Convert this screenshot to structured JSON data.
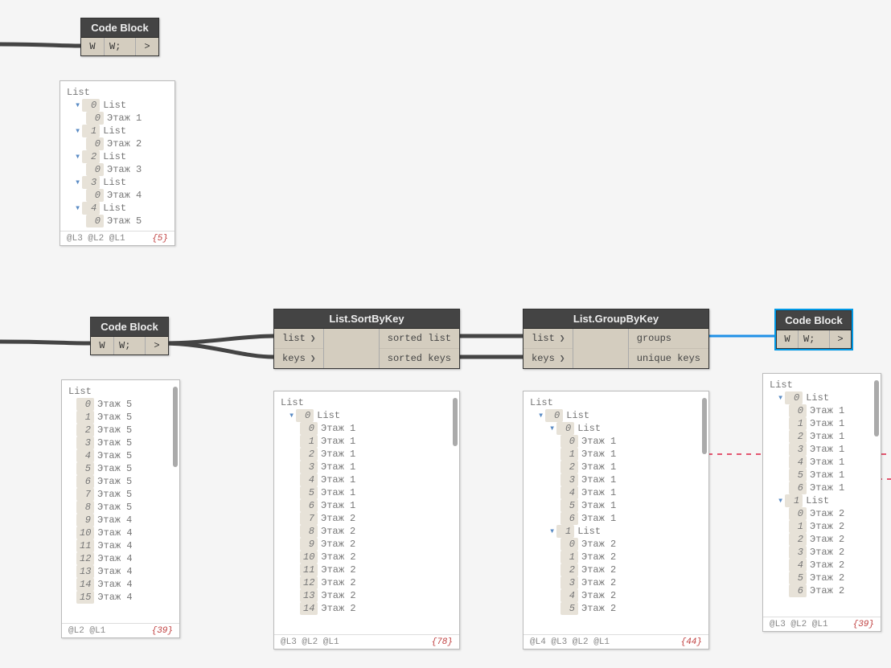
{
  "nodes": {
    "cb1": {
      "title": "Code Block",
      "in": "W",
      "code": "W;",
      "out": ">"
    },
    "cb2": {
      "title": "Code Block",
      "in": "W",
      "code": "W;",
      "out": ">"
    },
    "cb3": {
      "title": "Code Block",
      "in": "W",
      "code": "W;",
      "out": ">"
    },
    "sort": {
      "title": "List.SortByKey",
      "in": [
        {
          "label": "list"
        },
        {
          "label": "keys"
        }
      ],
      "out": [
        {
          "label": "sorted list"
        },
        {
          "label": "sorted keys"
        }
      ]
    },
    "group": {
      "title": "List.GroupByKey",
      "in": [
        {
          "label": "list"
        },
        {
          "label": "keys"
        }
      ],
      "out": [
        {
          "label": "groups"
        },
        {
          "label": "unique keys"
        }
      ]
    }
  },
  "previews": {
    "p1": {
      "levels": "@L3 @L2 @L1",
      "count": "{5}",
      "root": "List",
      "items": [
        {
          "idx": "0",
          "sub": "List",
          "child": {
            "idx": "0",
            "val": "Этаж 1"
          }
        },
        {
          "idx": "1",
          "sub": "List",
          "child": {
            "idx": "0",
            "val": "Этаж 2"
          }
        },
        {
          "idx": "2",
          "sub": "List",
          "child": {
            "idx": "0",
            "val": "Этаж 3"
          }
        },
        {
          "idx": "3",
          "sub": "List",
          "child": {
            "idx": "0",
            "val": "Этаж 4"
          }
        },
        {
          "idx": "4",
          "sub": "List",
          "child": {
            "idx": "0",
            "val": "Этаж 5"
          }
        }
      ]
    },
    "p2": {
      "levels": "@L2 @L1",
      "count": "{39}",
      "root": "List",
      "flat": [
        {
          "i": "0",
          "v": "Этаж 5"
        },
        {
          "i": "1",
          "v": "Этаж 5"
        },
        {
          "i": "2",
          "v": "Этаж 5"
        },
        {
          "i": "3",
          "v": "Этаж 5"
        },
        {
          "i": "4",
          "v": "Этаж 5"
        },
        {
          "i": "5",
          "v": "Этаж 5"
        },
        {
          "i": "6",
          "v": "Этаж 5"
        },
        {
          "i": "7",
          "v": "Этаж 5"
        },
        {
          "i": "8",
          "v": "Этаж 5"
        },
        {
          "i": "9",
          "v": "Этаж 4"
        },
        {
          "i": "10",
          "v": "Этаж 4"
        },
        {
          "i": "11",
          "v": "Этаж 4"
        },
        {
          "i": "12",
          "v": "Этаж 4"
        },
        {
          "i": "13",
          "v": "Этаж 4"
        },
        {
          "i": "14",
          "v": "Этаж 4"
        },
        {
          "i": "15",
          "v": "Этаж 4"
        }
      ]
    },
    "p3": {
      "levels": "@L3 @L2 @L1",
      "count": "{78}",
      "root": "List",
      "head": {
        "idx": "0",
        "sub": "List"
      },
      "flat": [
        {
          "i": "0",
          "v": "Этаж 1"
        },
        {
          "i": "1",
          "v": "Этаж 1"
        },
        {
          "i": "2",
          "v": "Этаж 1"
        },
        {
          "i": "3",
          "v": "Этаж 1"
        },
        {
          "i": "4",
          "v": "Этаж 1"
        },
        {
          "i": "5",
          "v": "Этаж 1"
        },
        {
          "i": "6",
          "v": "Этаж 1"
        },
        {
          "i": "7",
          "v": "Этаж 2"
        },
        {
          "i": "8",
          "v": "Этаж 2"
        },
        {
          "i": "9",
          "v": "Этаж 2"
        },
        {
          "i": "10",
          "v": "Этаж 2"
        },
        {
          "i": "11",
          "v": "Этаж 2"
        },
        {
          "i": "12",
          "v": "Этаж 2"
        },
        {
          "i": "13",
          "v": "Этаж 2"
        },
        {
          "i": "14",
          "v": "Этаж 2"
        }
      ]
    },
    "p4": {
      "levels": "@L4 @L3 @L2 @L1",
      "count": "{44}",
      "root": "List",
      "head": {
        "idx": "0",
        "sub": "List"
      },
      "groups": [
        {
          "idx": "0",
          "sub": "List",
          "flat": [
            {
              "i": "0",
              "v": "Этаж 1"
            },
            {
              "i": "1",
              "v": "Этаж 1"
            },
            {
              "i": "2",
              "v": "Этаж 1"
            },
            {
              "i": "3",
              "v": "Этаж 1"
            },
            {
              "i": "4",
              "v": "Этаж 1"
            },
            {
              "i": "5",
              "v": "Этаж 1"
            },
            {
              "i": "6",
              "v": "Этаж 1"
            }
          ]
        },
        {
          "idx": "1",
          "sub": "List",
          "flat": [
            {
              "i": "0",
              "v": "Этаж 2"
            },
            {
              "i": "1",
              "v": "Этаж 2"
            },
            {
              "i": "2",
              "v": "Этаж 2"
            },
            {
              "i": "3",
              "v": "Этаж 2"
            },
            {
              "i": "4",
              "v": "Этаж 2"
            },
            {
              "i": "5",
              "v": "Этаж 2"
            }
          ]
        }
      ]
    },
    "p5": {
      "levels": "@L3 @L2 @L1",
      "count": "{39}",
      "root": "List",
      "groups": [
        {
          "idx": "0",
          "sub": "List",
          "flat": [
            {
              "i": "0",
              "v": "Этаж 1"
            },
            {
              "i": "1",
              "v": "Этаж 1"
            },
            {
              "i": "2",
              "v": "Этаж 1"
            },
            {
              "i": "3",
              "v": "Этаж 1"
            },
            {
              "i": "4",
              "v": "Этаж 1"
            },
            {
              "i": "5",
              "v": "Этаж 1"
            },
            {
              "i": "6",
              "v": "Этаж 1"
            }
          ]
        },
        {
          "idx": "1",
          "sub": "List",
          "flat": [
            {
              "i": "0",
              "v": "Этаж 2"
            },
            {
              "i": "1",
              "v": "Этаж 2"
            },
            {
              "i": "2",
              "v": "Этаж 2"
            },
            {
              "i": "3",
              "v": "Этаж 2"
            },
            {
              "i": "4",
              "v": "Этаж 2"
            },
            {
              "i": "5",
              "v": "Этаж 2"
            },
            {
              "i": "6",
              "v": "Этаж 2"
            }
          ]
        }
      ]
    }
  }
}
